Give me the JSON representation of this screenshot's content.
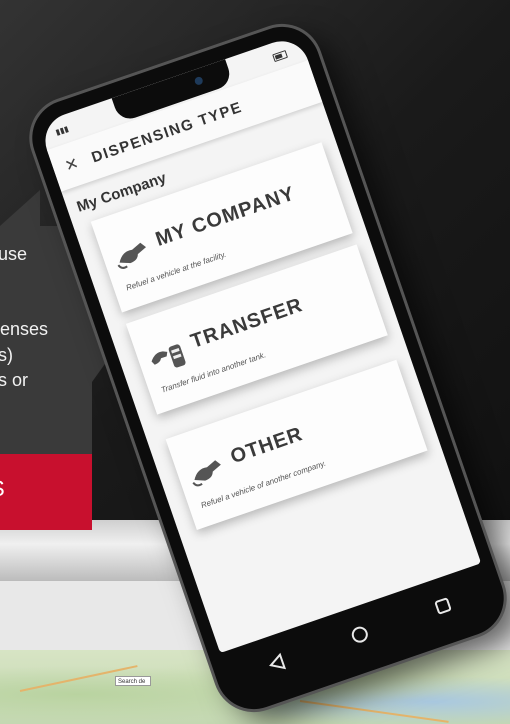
{
  "tooltip": {
    "line1": "use",
    "line2": "",
    "line3": "enses",
    "line4": "s)",
    "line5": "s or",
    "red_label": "S"
  },
  "phone": {
    "header": {
      "title": "DISPENSING TYPE",
      "close_icon": "close-icon"
    },
    "section_label": "My Company",
    "options": [
      {
        "title": "MY COMPANY",
        "description": "Refuel a vehicle at the facility.",
        "icon": "fuel-nozzle-icon"
      },
      {
        "title": "TRANSFER",
        "description": "Transfer fluid into another tank.",
        "icon": "fuel-transfer-icon"
      },
      {
        "title": "OTHER",
        "description": "Refuel a vehicle of another company.",
        "icon": "fuel-nozzle-icon"
      }
    ],
    "nav": {
      "back_icon": "back-triangle-icon",
      "home_icon": "home-circle-icon",
      "recents_icon": "recents-square-icon"
    }
  },
  "background": {
    "map_label": "Search de"
  },
  "colors": {
    "accent_red": "#c8102e",
    "tooltip_bg": "#3a3a3a",
    "phone_body": "#0c0c0c"
  }
}
